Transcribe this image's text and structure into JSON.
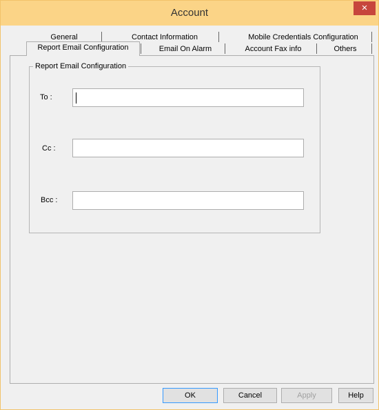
{
  "window": {
    "title": "Account",
    "close_glyph": "×"
  },
  "tabs": {
    "row1": [
      "General",
      "Contact Information",
      "Mobile Credentials Configuration"
    ],
    "row2": [
      "Report Email Configuration",
      "Email On Alarm",
      "Account Fax info",
      "Others"
    ],
    "selected": "Report Email Configuration"
  },
  "group": {
    "label": "Report Email Configuration",
    "fields": [
      {
        "label": "To :",
        "value": ""
      },
      {
        "label": "Cc :",
        "value": ""
      },
      {
        "label": "Bcc :",
        "value": ""
      }
    ]
  },
  "buttons": {
    "ok": "OK",
    "cancel": "Cancel",
    "apply": "Apply",
    "help": "Help"
  },
  "icons": {
    "close": "close-icon"
  },
  "colors": {
    "title_bar": "#fbd487",
    "close_button": "#c7463d"
  }
}
